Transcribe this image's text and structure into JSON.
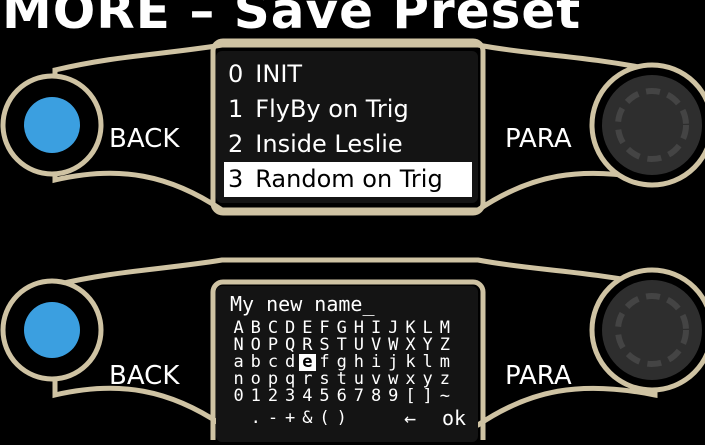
{
  "title": "MORE – Save Preset",
  "colors": {
    "frame": "#cfc3a3",
    "button": "#3b9fe0",
    "knob": "#2e2e2e",
    "screen": "#141414"
  },
  "panel_top": {
    "back_label": "BACK",
    "para_label": "PARA",
    "presets": [
      {
        "index": "0",
        "name": "INIT",
        "selected": false
      },
      {
        "index": "1",
        "name": "FlyBy on Trig",
        "selected": false
      },
      {
        "index": "2",
        "name": "Inside Leslie",
        "selected": false
      },
      {
        "index": "3",
        "name": "Random on Trig",
        "selected": true
      }
    ]
  },
  "panel_bottom": {
    "back_label": "BACK",
    "para_label": "PARA",
    "name_value": "My new name_",
    "keyboard_rows": [
      [
        "A",
        "B",
        "C",
        "D",
        "E",
        "F",
        "G",
        "H",
        "I",
        "J",
        "K",
        "L",
        "M"
      ],
      [
        "N",
        "O",
        "P",
        "Q",
        "R",
        "S",
        "T",
        "U",
        "V",
        "W",
        "X",
        "Y",
        "Z"
      ],
      [
        "a",
        "b",
        "c",
        "d",
        "e",
        "f",
        "g",
        "h",
        "i",
        "j",
        "k",
        "l",
        "m"
      ],
      [
        "n",
        "o",
        "p",
        "q",
        "r",
        "s",
        "t",
        "u",
        "v",
        "w",
        "x",
        "y",
        "z"
      ],
      [
        "0",
        "1",
        "2",
        "3",
        "4",
        "5",
        "6",
        "7",
        "8",
        "9",
        "[",
        "]",
        "~"
      ]
    ],
    "active_key": "e",
    "bottom_keys": [
      " ",
      ".",
      "-",
      "+",
      "&",
      "(",
      ")"
    ],
    "arrow_key": "←",
    "ok_key": "ok"
  }
}
